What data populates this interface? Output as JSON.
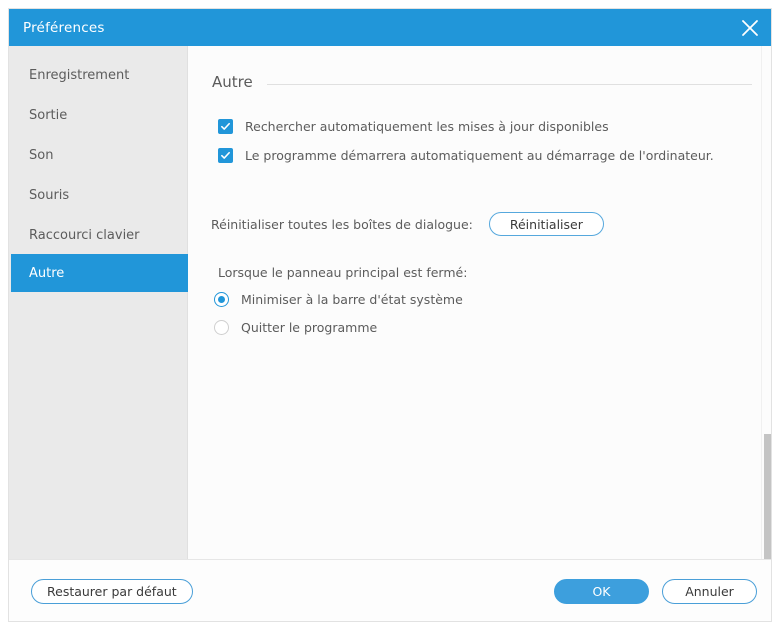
{
  "window": {
    "title": "Préférences",
    "close_icon": "close-x-icon",
    "accent_color": "#2196d9",
    "titlebar_color": "#2196d9",
    "sidebar_color": "#eaeaea",
    "content_color": "#fcfcfc"
  },
  "sidebar": {
    "items": [
      {
        "label": "Enregistrement",
        "active": false
      },
      {
        "label": "Sortie",
        "active": false
      },
      {
        "label": "Son",
        "active": false
      },
      {
        "label": "Souris",
        "active": false
      },
      {
        "label": "Raccourci clavier",
        "active": false
      },
      {
        "label": "Autre",
        "active": true
      }
    ]
  },
  "content": {
    "section_title": "Autre",
    "checkboxes": [
      {
        "label": "Rechercher automatiquement les mises à jour disponibles",
        "checked": true
      },
      {
        "label": "Le programme démarrera automatiquement au démarrage de l'ordinateur.",
        "checked": true
      }
    ],
    "reset_row": {
      "label": "Réinitialiser toutes les boîtes de dialogue:",
      "button_label": "Réinitialiser"
    },
    "radio_group": {
      "caption": "Lorsque le panneau principal est fermé:",
      "options": [
        {
          "label": "Minimiser à la barre d'état système",
          "selected": true
        },
        {
          "label": "Quitter le programme",
          "selected": false
        }
      ]
    }
  },
  "footer": {
    "restore_label": "Restaurer par défaut",
    "ok_label": "OK",
    "cancel_label": "Annuler"
  }
}
